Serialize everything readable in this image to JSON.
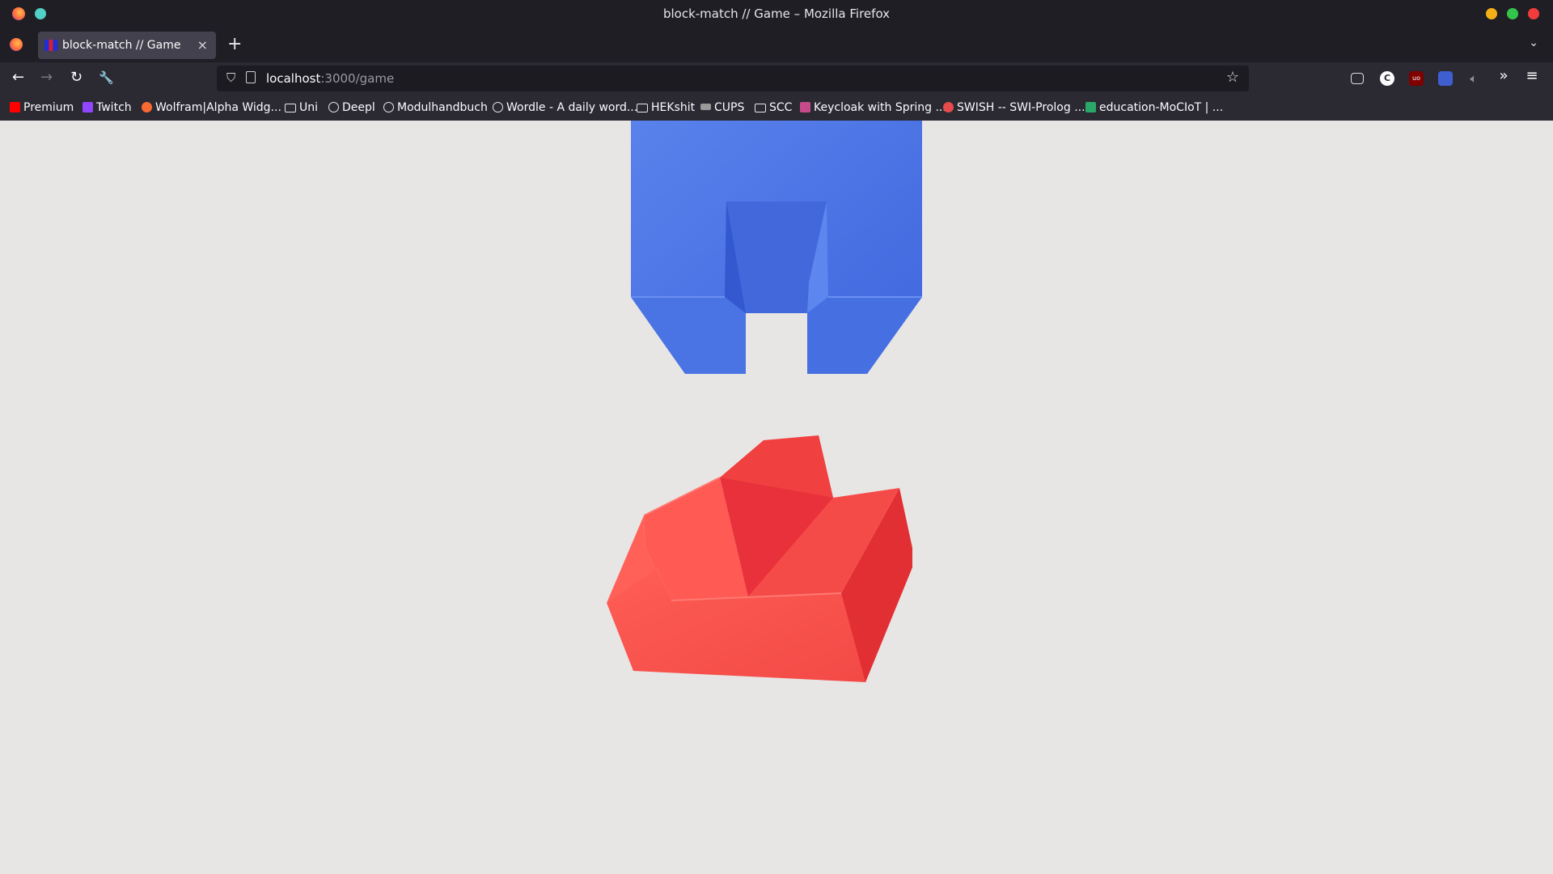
{
  "window": {
    "title": "block-match // Game – Mozilla Firefox"
  },
  "tabs": [
    {
      "label": "block-match // Game",
      "active": true
    }
  ],
  "toolbar": {
    "back": "←",
    "forward": "→",
    "reload": "↻",
    "tools": "🔧",
    "new_tab": "+",
    "list_all_tabs": "⌄",
    "close_tab": "×"
  },
  "url": {
    "host": "localhost",
    "path": ":3000/game",
    "bookmark_star": "☆"
  },
  "extensions": {
    "overflow": "»",
    "menu": "≡"
  },
  "bookmarks": [
    {
      "label": "Premium",
      "icon": "youtube-icon"
    },
    {
      "label": "Twitch",
      "icon": "twitch-icon"
    },
    {
      "label": "Wolfram|Alpha Widg...",
      "icon": "wolfram-icon"
    },
    {
      "label": "Uni",
      "icon": "folder-icon"
    },
    {
      "label": "Deepl",
      "icon": "globe-icon"
    },
    {
      "label": "Modulhandbuch",
      "icon": "globe-icon"
    },
    {
      "label": "Wordle - A daily word...",
      "icon": "globe-icon"
    },
    {
      "label": "HEKshit",
      "icon": "folder-icon"
    },
    {
      "label": "CUPS",
      "icon": "cups-icon"
    },
    {
      "label": "SCC",
      "icon": "folder-icon"
    },
    {
      "label": "Keycloak with Spring ...",
      "icon": "keycloak-icon"
    },
    {
      "label": "SWISH -- SWI-Prolog ...",
      "icon": "swish-icon"
    },
    {
      "label": "education-MoCIoT | ...",
      "icon": "chart-icon"
    }
  ],
  "game": {
    "colors": {
      "blue_block": "#4a78e6",
      "red_block": "#f04848",
      "background": "#e8e6e5"
    }
  }
}
